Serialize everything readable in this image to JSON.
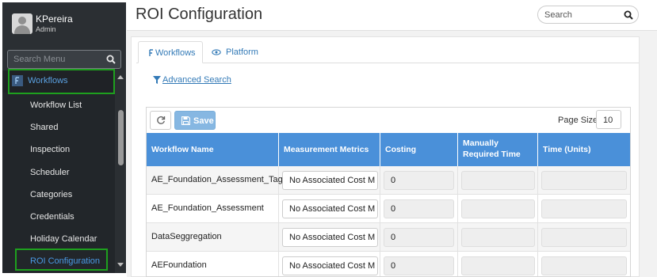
{
  "user": {
    "name": "KPereira",
    "role": "Admin"
  },
  "sidebar": {
    "search_placeholder": "Search Menu",
    "section": {
      "label": "Workflows",
      "icon": "workflow-icon"
    },
    "items": [
      {
        "label": "Workflow List",
        "active": false
      },
      {
        "label": "Shared",
        "active": false
      },
      {
        "label": "Inspection",
        "active": false
      },
      {
        "label": "Scheduler",
        "active": false
      },
      {
        "label": "Categories",
        "active": false
      },
      {
        "label": "Credentials",
        "active": false
      },
      {
        "label": "Holiday Calendar",
        "active": false
      },
      {
        "label": "ROI Configuration",
        "active": true
      }
    ]
  },
  "header": {
    "title": "ROI Configuration",
    "search_placeholder": "Search"
  },
  "tabs": [
    {
      "label": "Workflows",
      "icon": "workflow-icon",
      "active": true
    },
    {
      "label": "Platform",
      "icon": "eye-icon",
      "active": false
    }
  ],
  "advanced_search": {
    "label": "Advanced Search",
    "icon": "funnel-icon"
  },
  "toolbar": {
    "save_label": "Save",
    "page_size_label": "Page Size",
    "page_size_value": "10"
  },
  "table": {
    "columns": [
      "Workflow Name",
      "Measurement Metrics",
      "Costing",
      "Manually Required Time",
      "Time (Units)"
    ],
    "rows": [
      {
        "name": "AE_Foundation_Assessment_Tags",
        "metric": "No Associated Cost M",
        "costing": "0",
        "manual_time": "",
        "time_units": ""
      },
      {
        "name": "AE_Foundation_Assessment",
        "metric": "No Associated Cost M",
        "costing": "0",
        "manual_time": "",
        "time_units": ""
      },
      {
        "name": "DataSeggregation",
        "metric": "No Associated Cost M",
        "costing": "0",
        "manual_time": "",
        "time_units": ""
      },
      {
        "name": "AEFoundation",
        "metric": "No Associated Cost M",
        "costing": "0",
        "manual_time": "",
        "time_units": ""
      }
    ]
  },
  "colors": {
    "sidebar_bg": "#2b2f33",
    "accent_blue": "#337ab7",
    "table_header": "#4a90d9",
    "highlight_green": "#1ea01e"
  }
}
